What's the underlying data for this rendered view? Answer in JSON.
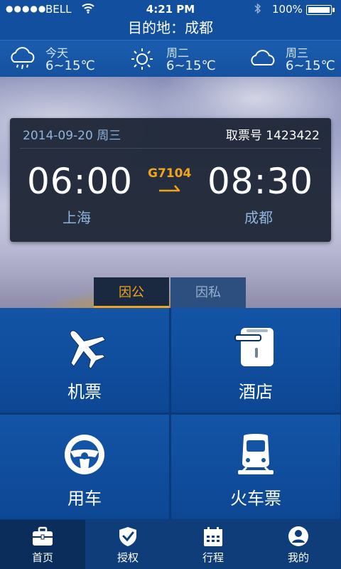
{
  "status_bar": {
    "signal": "●●●●●",
    "carrier": "BELL",
    "time": "4:21 PM",
    "battery": "100%"
  },
  "destination": "目的地：成都",
  "weather": [
    {
      "day": "今天",
      "temp": "6~15℃",
      "icon": "rain-cloud-icon"
    },
    {
      "day": "周二",
      "temp": "6~15℃",
      "icon": "sun-icon"
    },
    {
      "day": "周三",
      "temp": "6~15℃",
      "icon": "cloud-icon"
    }
  ],
  "ticket": {
    "date": "2014-09-20  周三",
    "ticket_no": "取票号 1423422",
    "departure_time": "06:00",
    "arrival_time": "08:30",
    "flight_no": "G7104",
    "departure_city": "上海",
    "arrival_city": "成都"
  },
  "segment": {
    "business": "因公",
    "personal": "因私"
  },
  "tiles": [
    {
      "label": "机票",
      "icon": "airplane-icon"
    },
    {
      "label": "酒店",
      "icon": "hotel-icon"
    },
    {
      "label": "用车",
      "icon": "steering-wheel-icon"
    },
    {
      "label": "火车票",
      "icon": "train-icon"
    }
  ],
  "tabbar": [
    {
      "label": "首页",
      "icon": "briefcase-icon"
    },
    {
      "label": "授权",
      "icon": "shield-icon"
    },
    {
      "label": "行程",
      "icon": "calendar-icon"
    },
    {
      "label": "我的",
      "icon": "user-icon"
    }
  ],
  "colors": {
    "accent": "#f3a51d",
    "primary": "#124f9e",
    "card": "#1c2434"
  }
}
